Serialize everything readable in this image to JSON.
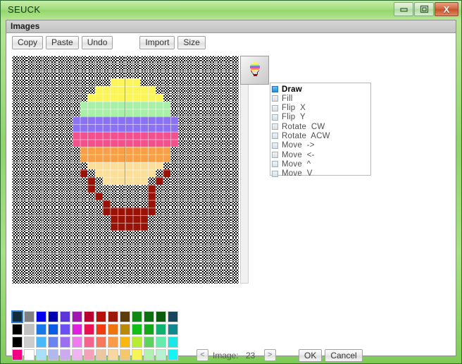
{
  "window": {
    "title": "SEUCK",
    "controls": [
      {
        "name": "minimize-button",
        "glyph": "—"
      },
      {
        "name": "maximize-button",
        "glyph": "❐"
      },
      {
        "name": "close-button",
        "glyph": "X"
      }
    ]
  },
  "tabs": [
    {
      "label": "Images",
      "active": true
    }
  ],
  "toolbar": {
    "copy_label": "Copy",
    "paste_label": "Paste",
    "undo_label": "Undo",
    "import_label": "Import",
    "size_label": "Size"
  },
  "tools": {
    "selected": "Draw",
    "items": [
      {
        "label": "Draw",
        "selected": true
      },
      {
        "label": "Fill",
        "selected": false
      },
      {
        "label": "Flip  X",
        "selected": false
      },
      {
        "label": "Flip  Y",
        "selected": false
      },
      {
        "label": "Rotate  CW",
        "selected": false
      },
      {
        "label": "Rotate  ACW",
        "selected": false
      },
      {
        "label": "Move  ->",
        "selected": false
      },
      {
        "label": "Move  <-",
        "selected": false
      },
      {
        "label": "Move  ^",
        "selected": false
      },
      {
        "label": "Move  V",
        "selected": false
      }
    ]
  },
  "navigation": {
    "prev_label": "<",
    "next_label": ">",
    "image_label": "Image:",
    "image_number": "23"
  },
  "dialog": {
    "ok_label": "OK",
    "cancel_label": "Cancel"
  },
  "palette": {
    "selected_index": 0,
    "rows": [
      [
        "#122b3a",
        "#808080",
        "#0000f0",
        "#0000b0",
        "#5a36d8",
        "#a016b0",
        "#b80030",
        "#b81008",
        "#9c1808",
        "#5c3c08",
        "#128814",
        "#0c7010",
        "#0a5c0c",
        "#14465c"
      ],
      [
        "#000000",
        "#c0c0c0",
        "#1878e8",
        "#0a5ce8",
        "#6a50f0",
        "#e020e0",
        "#ea1054",
        "#f23c10",
        "#ee7410",
        "#b88a08",
        "#10c018",
        "#12a818",
        "#10b070",
        "#108890"
      ],
      [
        "#000000",
        "#cccccc",
        "#48b8f8",
        "#6a84f0",
        "#9a70f0",
        "#f07af0",
        "#f4648c",
        "#f8785c",
        "#f89c48",
        "#fbb80c",
        "#b8ec34",
        "#5cd45c",
        "#64ecac",
        "#18e8e8"
      ],
      [
        "#f40084",
        "#fdfdfd",
        "#a8e0f8",
        "#b0b8f0",
        "#ccaaf0",
        "#f0b4f0",
        "#f4a0b8",
        "#ecc8a0",
        "#f8d8a0",
        "#f4c868",
        "#f8f458",
        "#b0f0b0",
        "#b8f0d0",
        "#14f4f4"
      ]
    ]
  },
  "sprite": {
    "width": 30,
    "height": 30,
    "legend": {
      "_": null,
      "Y": "#fbf55a",
      "G": "#a8efa8",
      "P": "#8a72f2",
      "K": "#f4508c",
      "O": "#f8a048",
      "C": "#fade9a",
      "B": "#981208"
    },
    "rows": [
      "______________________________",
      "______________________________",
      "______________________________",
      "_____________YYYY_____________",
      "___________YYYYYYYY___________",
      "__________YYYYYYYYYY__________",
      "_________GGGGGGGGGGGG_________",
      "_________GGGGGGGGGGGG_________",
      "________PPPPPPPPPPPPPP________",
      "________PPPPPPPPPPPPPP________",
      "________KKKKKKKKKKKKKK________",
      "________KKKKKKKKKKKKKK________",
      "_________OOOOOOOOOOOO_________",
      "_________OOOOOOOOOOOO_________",
      "__________CCCCCCCCCC__________",
      "_________B_CCCCCCCC_B_________",
      "__________B_CCCCCC_B__________",
      "__________B_______B___________",
      "___________B______B___________",
      "____________B_____B___________",
      "____________BBBBBBB___________",
      "_____________BBBBB____________",
      "_____________BBBBB____________",
      "______________________________",
      "______________________________",
      "______________________________",
      "______________________________",
      "______________________________",
      "______________________________",
      "______________________________"
    ]
  },
  "scrollbar": {
    "orientation": "vertical",
    "thumb_position_percent": 0
  }
}
